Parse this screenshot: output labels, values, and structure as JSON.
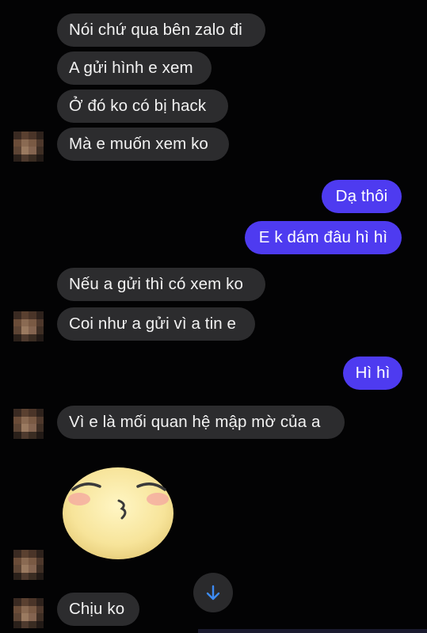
{
  "messages": {
    "m1": "Nói chứ qua bên zalo đi",
    "m2": "A gửi hình e xem",
    "m3": "Ở đó ko có bị hack",
    "m4": "Mà e muốn xem ko",
    "m5": "Dạ thôi",
    "m6": "E k dám đâu hì hì",
    "m7": "Nếu a gửi thì có xem ko",
    "m8": "Coi như a gửi vì a tin e",
    "m9": "Hì hì",
    "m10": "Vì e là mối quan hệ mập mờ của a",
    "m11": "Chịu ko"
  },
  "sticker": "kiss-face-sticker",
  "icons": {
    "scroll": "arrow-down-icon",
    "avatar": "pixelated-avatar"
  },
  "colors": {
    "background": "#030304",
    "incoming_bubble": "#2c2c2e",
    "outgoing_bubble": "#4e3bf0",
    "scroll_arrow": "#3d8bf5"
  }
}
